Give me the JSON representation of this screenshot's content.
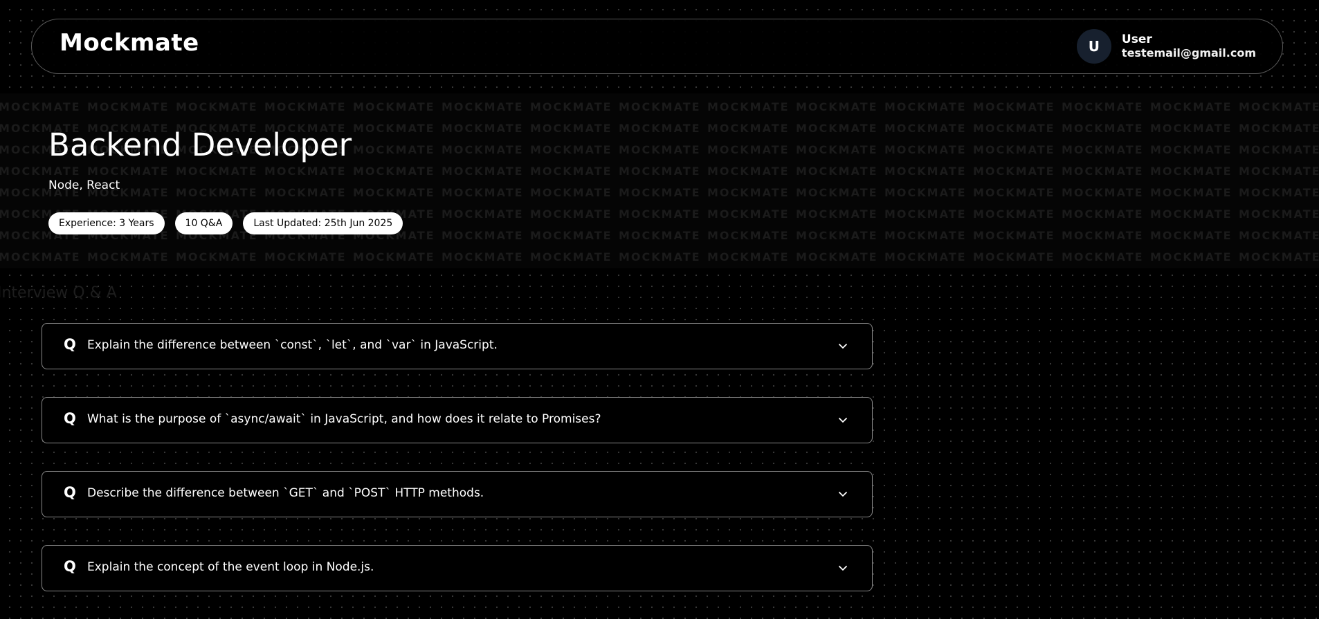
{
  "header": {
    "logo": "Mockmate",
    "user": {
      "avatar_initial": "U",
      "name": "User",
      "email": "testemail@gmail.com"
    }
  },
  "hero": {
    "watermark_text": "MOCKMATE",
    "title": "Backend Developer",
    "tech_stack": "Node, React",
    "badges": {
      "experience": "Experience: 3 Years",
      "qa_count": "10 Q&A",
      "last_updated": "Last Updated: 25th Jun 2025"
    }
  },
  "qa_section": {
    "heading": "Interview Q & A",
    "q_prefix": "Q",
    "questions": [
      "Explain the difference between `const`, `let`, and `var` in JavaScript.",
      "What is the purpose of `async/await` in JavaScript, and how does it relate to Promises?",
      "Describe the difference between `GET` and `POST` HTTP methods.",
      "Explain the concept of the event loop in Node.js."
    ]
  },
  "colors": {
    "background": "#000000",
    "text": "#ffffff",
    "avatar_bg": "#17202e",
    "border": "#8a8a8a"
  },
  "icons": {
    "expand": "chevron-down-icon"
  }
}
